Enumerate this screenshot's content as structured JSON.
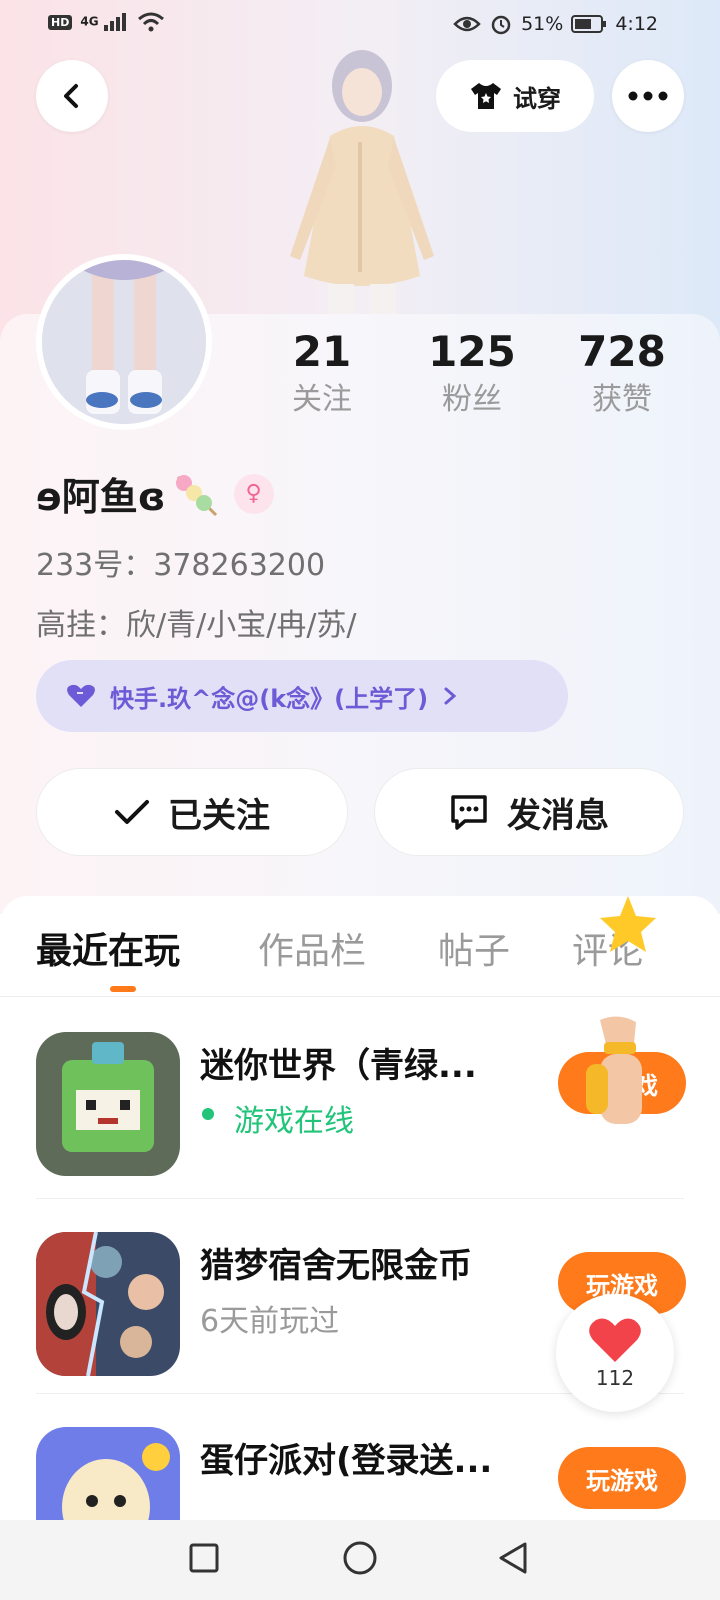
{
  "status_bar": {
    "hd_badge": "HD",
    "signal": "4G",
    "battery_pct": "51%",
    "time": "4:12"
  },
  "header": {
    "try_on_label": "试穿"
  },
  "profile": {
    "nickname": "ɘ阿鱼ɞ",
    "gender_symbol": "♀",
    "id_line": "233号：378263200",
    "bio_line": "高挂：欣/青/小宝/冉/苏/",
    "relation_text": "快手.玖^念@(k念》(上学了)",
    "stats": [
      {
        "value": "21",
        "label": "关注"
      },
      {
        "value": "125",
        "label": "粉丝"
      },
      {
        "value": "728",
        "label": "获赞"
      }
    ]
  },
  "actions": {
    "followed_label": "已关注",
    "message_label": "发消息"
  },
  "tabs": [
    {
      "label": "最近在玩",
      "active": true
    },
    {
      "label": "作品栏",
      "active": false
    },
    {
      "label": "帖子",
      "active": false
    },
    {
      "label": "评论",
      "active": false
    }
  ],
  "games": [
    {
      "title": "迷你世界（青绿...",
      "subtitle": "游戏在线",
      "online": true,
      "button": "玩游戏"
    },
    {
      "title": "猎梦宿舍无限金币",
      "subtitle": "6天前玩过",
      "online": false,
      "button": "玩游戏"
    },
    {
      "title": "蛋仔派对(登录送...",
      "subtitle": "",
      "online": false,
      "button": "玩游戏"
    }
  ],
  "like_float": {
    "count": "112"
  },
  "colors": {
    "accent_orange": "#ff7a1a",
    "online_green": "#22c47a",
    "relation_purple": "#6c5bd6"
  }
}
